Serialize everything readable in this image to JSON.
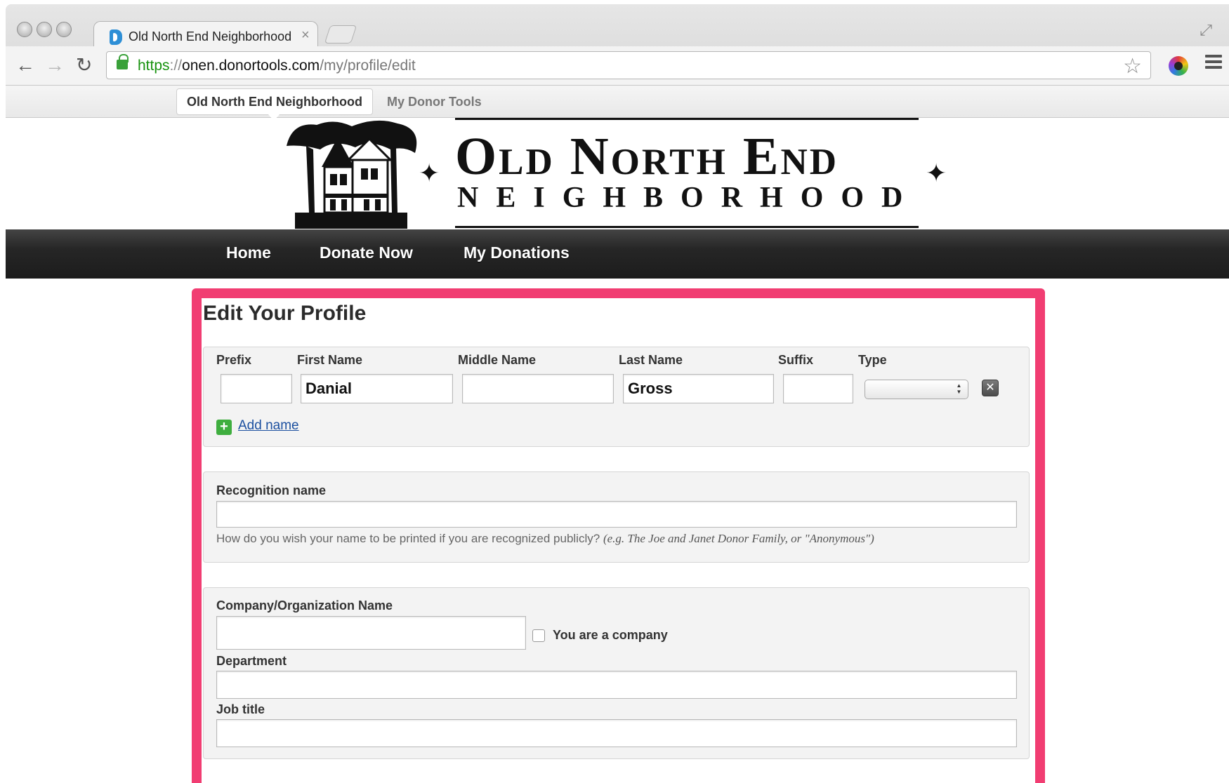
{
  "browser": {
    "tab_title": "Old North End Neighborhood",
    "tab_close": "×",
    "url_scheme": "https",
    "url_sep": "://",
    "url_host": "onen.donortools.com",
    "url_path": "/my/profile/edit",
    "back_glyph": "←",
    "forward_glyph": "→",
    "reload_glyph": "↻",
    "star_glyph": "☆",
    "expand_glyph": "⤢"
  },
  "site_tabs": {
    "active": "Old North End Neighborhood",
    "other": "My Donor Tools"
  },
  "logo": {
    "line1": "Old North End",
    "line2": "NEIGHBORHOOD",
    "sparkle": "✦"
  },
  "nav": {
    "items": [
      "Home",
      "Donate Now",
      "My Donations"
    ]
  },
  "page": {
    "title": "Edit Your Profile"
  },
  "name_panel": {
    "labels": {
      "prefix": "Prefix",
      "first": "First Name",
      "middle": "Middle Name",
      "last": "Last Name",
      "suffix": "Suffix",
      "type": "Type"
    },
    "values": {
      "prefix": "",
      "first": "Danial",
      "middle": "",
      "last": "Gross",
      "suffix": ""
    },
    "type_selected": "",
    "type_arrows": "▲▼",
    "remove_glyph": "✕",
    "add_glyph": "+",
    "add_link": "Add name"
  },
  "recognition_panel": {
    "label": "Recognition name",
    "value": "",
    "hint": "How do you wish your name to be printed if you are recognized publicly?",
    "hint_example": "(e.g. The Joe and Janet Donor Family, or \"Anonymous\")"
  },
  "company_panel": {
    "company_label": "Company/Organization Name",
    "company_value": "",
    "is_company_label": "You are a company",
    "is_company_checked": false,
    "department_label": "Department",
    "department_value": "",
    "job_title_label": "Job title",
    "job_title_value": ""
  },
  "colors": {
    "highlight": "#f13d72",
    "nav_bg": "#262626",
    "link": "#1b4f9f",
    "add_icon": "#3fae3f",
    "url_scheme": "#17920e"
  }
}
